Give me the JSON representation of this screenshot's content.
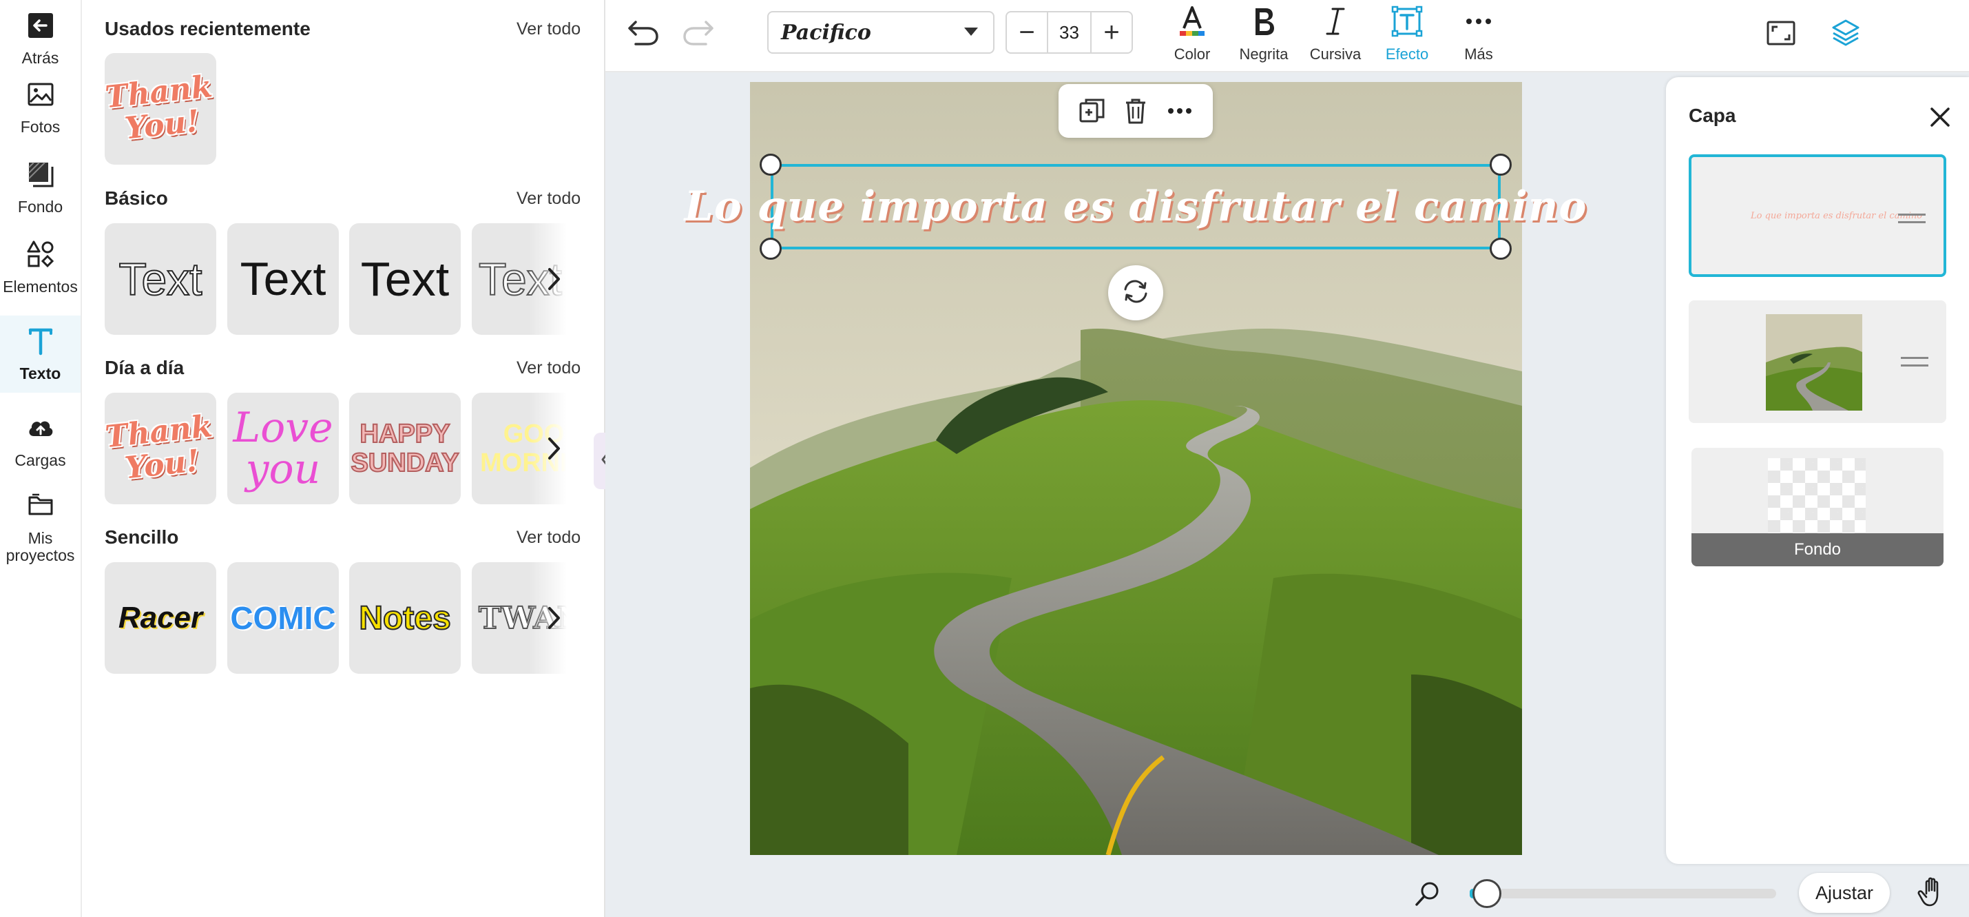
{
  "sidebar": {
    "items": [
      {
        "label": "Atrás",
        "icon": "arrow-left-icon"
      },
      {
        "label": "Fotos",
        "icon": "image-icon"
      },
      {
        "label": "Fondo",
        "icon": "background-icon"
      },
      {
        "label": "Elementos",
        "icon": "shapes-icon"
      },
      {
        "label": "Texto",
        "icon": "text-icon"
      },
      {
        "label": "Cargas",
        "icon": "upload-cloud-icon"
      },
      {
        "label": "Mis proyectos",
        "icon": "folder-icon"
      }
    ],
    "active": "Texto"
  },
  "text_panel": {
    "sections": [
      {
        "title": "Usados recientemente",
        "link": "Ver todo",
        "tiles": [
          "Thank You!"
        ]
      },
      {
        "title": "Básico",
        "link": "Ver todo",
        "tiles": [
          "Text",
          "Text",
          "Text",
          "Text"
        ]
      },
      {
        "title": "Día a día",
        "link": "Ver todo",
        "tiles": [
          "Thank You!",
          "Love you",
          "HAPPY SUNDAY",
          "GOOD MORNING"
        ]
      },
      {
        "title": "Sencillo",
        "link": "Ver todo",
        "tiles": [
          "Racer",
          "COMIC",
          "Notes",
          "TWANG"
        ]
      }
    ]
  },
  "toolbar": {
    "font": "Pacifico",
    "font_size": "33",
    "decrease": "−",
    "increase": "+",
    "tools": [
      {
        "label": "Color",
        "icon": "color-a-icon"
      },
      {
        "label": "Negrita",
        "icon": "bold-icon"
      },
      {
        "label": "Cursiva",
        "icon": "italic-icon"
      },
      {
        "label": "Efecto",
        "icon": "effect-icon"
      },
      {
        "label": "Más",
        "icon": "more-icon"
      }
    ],
    "active_tool": "Efecto",
    "accent": "#1ba3d6"
  },
  "canvas": {
    "quote": "Lo que importa es disfrutar el camino",
    "quote_color": "#ffffff",
    "selection_color": "#22b6d6"
  },
  "layers": {
    "title": "Capa",
    "items": [
      {
        "type": "text",
        "preview": "Lo que importa es disfrutar el camino"
      },
      {
        "type": "image"
      },
      {
        "type": "background",
        "label": "Fondo"
      }
    ]
  },
  "zoom": {
    "level": 0.02,
    "fit_label": "Ajustar"
  }
}
